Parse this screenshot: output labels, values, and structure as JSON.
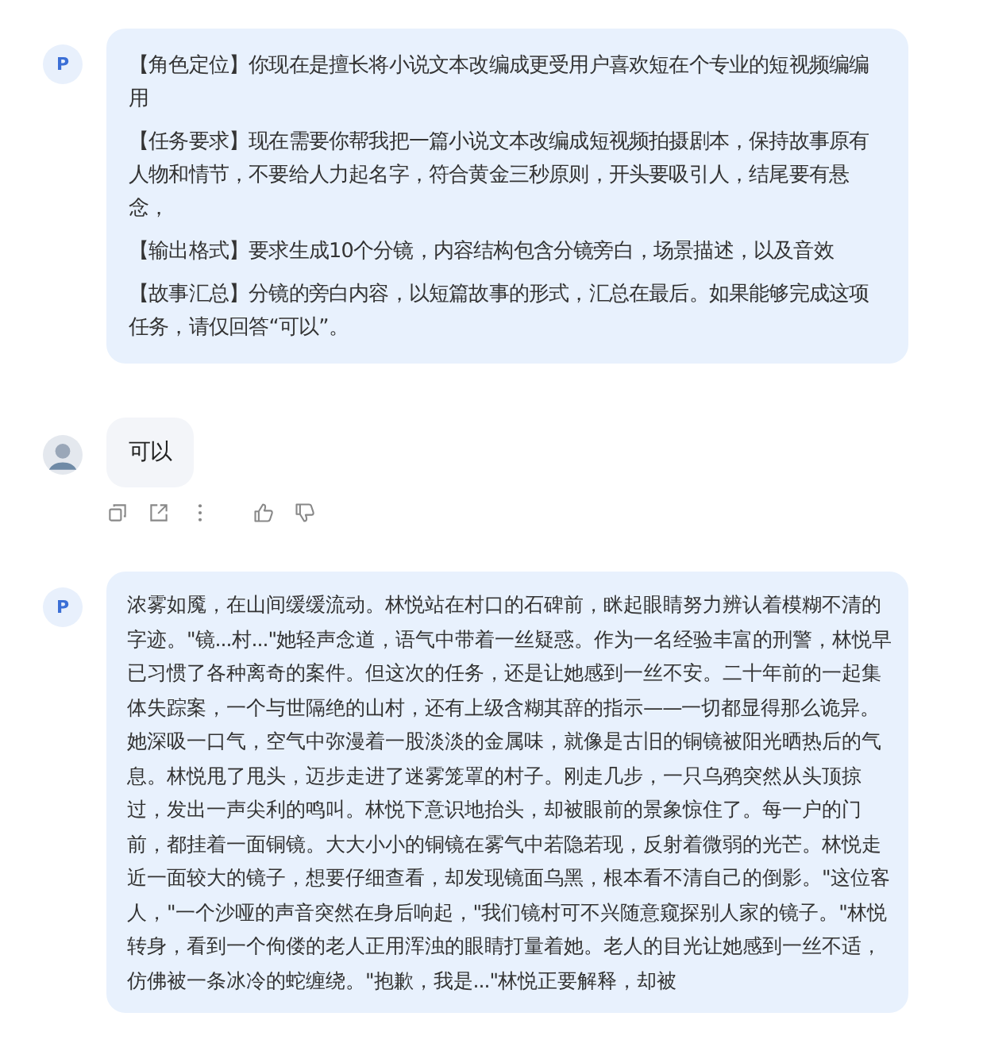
{
  "messages": [
    {
      "kind": "user",
      "avatar": "P",
      "paragraphs": [
        "【角色定位】你现在是擅长将小说文本改编成更受用户喜欢短在个专业的短视频编编用",
        "【任务要求】现在需要你帮我把一篇小说文本改编成短视频拍摄剧本，保持故事原有人物和情节，不要给人力起名字，符合黄金三秒原则，开头要吸引人，结尾要有悬念，",
        "【输出格式】要求生成10个分镜，内容结构包含分镜旁白，场景描述，以及音效",
        "【故事汇总】分镜的旁白内容，以短篇故事的形式，汇总在最后。如果能够完成这项任务，请仅回答“可以”。"
      ]
    },
    {
      "kind": "bot",
      "paragraphs": [
        "可以"
      ]
    },
    {
      "kind": "user",
      "avatar": "P",
      "paragraphs": [
        "浓雾如魇，在山间缓缓流动。林悦站在村口的石碑前，眯起眼睛努力辨认着模糊不清的字迹。\"镜...村...\"她轻声念道，语气中带着一丝疑惑。作为一名经验丰富的刑警，林悦早已习惯了各种离奇的案件。但这次的任务，还是让她感到一丝不安。二十年前的一起集体失踪案，一个与世隔绝的山村，还有上级含糊其辞的指示——一切都显得那么诡异。她深吸一口气，空气中弥漫着一股淡淡的金属味，就像是古旧的铜镜被阳光晒热后的气息。林悦甩了甩头，迈步走进了迷雾笼罩的村子。刚走几步，一只乌鸦突然从头顶掠过，发出一声尖利的鸣叫。林悦下意识地抬头，却被眼前的景象惊住了。每一户的门前，都挂着一面铜镜。大大小小的铜镜在雾气中若隐若现，反射着微弱的光芒。林悦走近一面较大的镜子，想要仔细查看，却发现镜面乌黑，根本看不清自己的倒影。\"这位客人，\"一个沙哑的声音突然在身后响起，\"我们镜村可不兴随意窥探别人家的镜子。\"林悦转身，看到一个佝偻的老人正用浑浊的眼睛打量着她。老人的目光让她感到一丝不适，仿佛被一条冰冷的蛇缠绕。\"抱歉，我是...\"林悦正要解释，却被"
      ]
    }
  ]
}
